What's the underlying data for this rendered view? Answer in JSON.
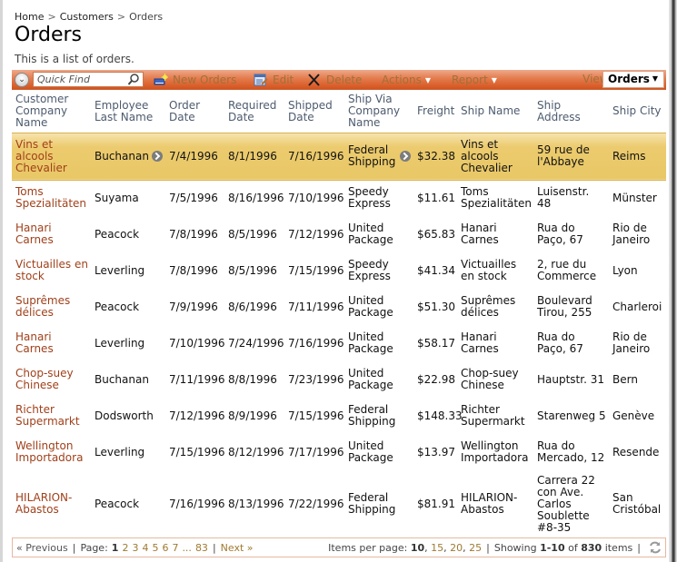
{
  "breadcrumb": {
    "items": [
      "Home",
      "Customers"
    ],
    "separator": ">",
    "current": "Orders"
  },
  "page": {
    "title": "Orders",
    "description": "This is a list of orders."
  },
  "toolbar": {
    "quick_find_placeholder": "Quick Find",
    "new_label": "New Orders",
    "edit_label": "Edit",
    "delete_label": "Delete",
    "actions_label": "Actions",
    "report_label": "Report",
    "view_label": "View:",
    "view_value": "Orders",
    "icons": {
      "collapse": "chevron-down-circle-icon",
      "search": "magnifier-icon",
      "new": "new-record-icon",
      "edit": "edit-form-icon",
      "delete": "x-icon"
    }
  },
  "grid": {
    "columns": [
      "Customer Company Name",
      "Employee Last Name",
      "Order Date",
      "Required Date",
      "Shipped Date",
      "Ship Via Company Name",
      "Freight",
      "Ship Name",
      "Ship Address",
      "Ship City"
    ],
    "rows": [
      {
        "customer": "Vins et alcools Chevalier",
        "employee": "Buchanan",
        "order_date": "7/4/1996",
        "required_date": "8/1/1996",
        "shipped_date": "7/16/1996",
        "ship_via": "Federal Shipping",
        "freight": "$32.38",
        "ship_name": "Vins et alcools Chevalier",
        "ship_address": "59 rue de l'Abbaye",
        "ship_city": "Reims",
        "selected": true
      },
      {
        "customer": "Toms Spezialitäten",
        "employee": "Suyama",
        "order_date": "7/5/1996",
        "required_date": "8/16/1996",
        "shipped_date": "7/10/1996",
        "ship_via": "Speedy Express",
        "freight": "$11.61",
        "ship_name": "Toms Spezialitäten",
        "ship_address": "Luisenstr. 48",
        "ship_city": "Münster"
      },
      {
        "customer": "Hanari Carnes",
        "employee": "Peacock",
        "order_date": "7/8/1996",
        "required_date": "8/5/1996",
        "shipped_date": "7/12/1996",
        "ship_via": "United Package",
        "freight": "$65.83",
        "ship_name": "Hanari Carnes",
        "ship_address": "Rua do Paço, 67",
        "ship_city": "Rio de Janeiro"
      },
      {
        "customer": "Victuailles en stock",
        "employee": "Leverling",
        "order_date": "7/8/1996",
        "required_date": "8/5/1996",
        "shipped_date": "7/15/1996",
        "ship_via": "Speedy Express",
        "freight": "$41.34",
        "ship_name": "Victuailles en stock",
        "ship_address": "2, rue du Commerce",
        "ship_city": "Lyon"
      },
      {
        "customer": "Suprêmes délices",
        "employee": "Peacock",
        "order_date": "7/9/1996",
        "required_date": "8/6/1996",
        "shipped_date": "7/11/1996",
        "ship_via": "United Package",
        "freight": "$51.30",
        "ship_name": "Suprêmes délices",
        "ship_address": "Boulevard Tirou, 255",
        "ship_city": "Charleroi"
      },
      {
        "customer": "Hanari Carnes",
        "employee": "Leverling",
        "order_date": "7/10/1996",
        "required_date": "7/24/1996",
        "shipped_date": "7/16/1996",
        "ship_via": "United Package",
        "freight": "$58.17",
        "ship_name": "Hanari Carnes",
        "ship_address": "Rua do Paço, 67",
        "ship_city": "Rio de Janeiro"
      },
      {
        "customer": "Chop-suey Chinese",
        "employee": "Buchanan",
        "order_date": "7/11/1996",
        "required_date": "8/8/1996",
        "shipped_date": "7/23/1996",
        "ship_via": "United Package",
        "freight": "$22.98",
        "ship_name": "Chop-suey Chinese",
        "ship_address": "Hauptstr. 31",
        "ship_city": "Bern"
      },
      {
        "customer": "Richter Supermarkt",
        "employee": "Dodsworth",
        "order_date": "7/12/1996",
        "required_date": "8/9/1996",
        "shipped_date": "7/15/1996",
        "ship_via": "Federal Shipping",
        "freight": "$148.33",
        "ship_name": "Richter Supermarkt",
        "ship_address": "Starenweg 5",
        "ship_city": "Genève"
      },
      {
        "customer": "Wellington Importadora",
        "employee": "Leverling",
        "order_date": "7/15/1996",
        "required_date": "8/12/1996",
        "shipped_date": "7/17/1996",
        "ship_via": "United Package",
        "freight": "$13.97",
        "ship_name": "Wellington Importadora",
        "ship_address": "Rua do Mercado, 12",
        "ship_city": "Resende"
      },
      {
        "customer": "HILARION-Abastos",
        "employee": "Peacock",
        "order_date": "7/16/1996",
        "required_date": "8/13/1996",
        "shipped_date": "7/22/1996",
        "ship_via": "Federal Shipping",
        "freight": "$81.91",
        "ship_name": "HILARION-Abastos",
        "ship_address": "Carrera 22 con Ave. Carlos Soublette #8-35",
        "ship_city": "San Cristóbal"
      }
    ]
  },
  "pager": {
    "previous_label": "« Previous",
    "page_label": "Page:",
    "current_page": "1",
    "pages": [
      "2",
      "3",
      "4",
      "5",
      "6",
      "7"
    ],
    "ellipsis": "...",
    "last_page": "83",
    "next_label": "Next »",
    "items_per_page_label": "Items per page:",
    "page_sizes": [
      "10",
      "15",
      "20",
      "25"
    ],
    "current_page_size": "10",
    "showing_label": "Showing",
    "range": "1-10",
    "of_label": "of",
    "total": "830",
    "items_label": "items"
  },
  "colors": {
    "toolbar_accent": "#e06a35",
    "selected_row": "#ebc96b",
    "link": "#a0401a",
    "pager_link": "#a07a30"
  }
}
